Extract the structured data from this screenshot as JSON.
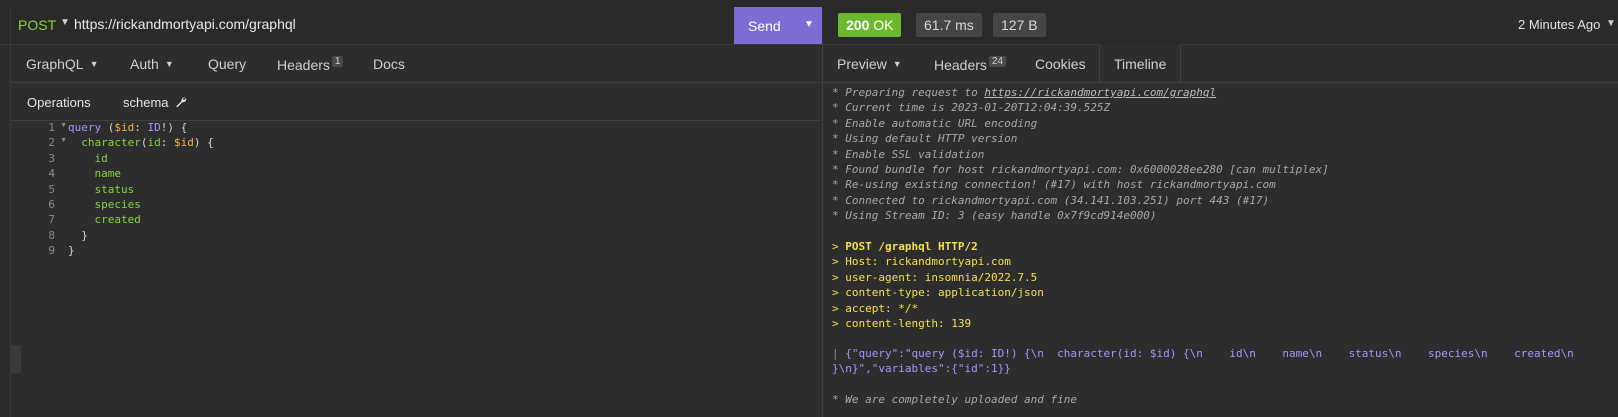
{
  "request": {
    "method": "POST",
    "url": "https://rickandmortyapi.com/graphql",
    "send_label": "Send"
  },
  "response": {
    "status_code": "200",
    "status_text": "OK",
    "time": "61.7 ms",
    "size": "127 B",
    "history_label": "2 Minutes Ago"
  },
  "left_tabs": [
    {
      "label": "GraphQL"
    },
    {
      "label": "Auth"
    },
    {
      "label": "Query"
    },
    {
      "label": "Headers",
      "count": "1"
    },
    {
      "label": "Docs"
    }
  ],
  "sub_tabs": {
    "operations": "Operations",
    "schema": "schema"
  },
  "editor": {
    "line_numbers": [
      "1",
      "2",
      "3",
      "4",
      "5",
      "6",
      "7",
      "8",
      "9"
    ],
    "fields": [
      "id",
      "name",
      "status",
      "species",
      "created"
    ]
  },
  "right_tabs": [
    {
      "label": "Preview"
    },
    {
      "label": "Headers",
      "count": "24"
    },
    {
      "label": "Cookies"
    },
    {
      "label": "Timeline"
    }
  ],
  "timeline": {
    "info": [
      "* Preparing request to ",
      "* Current time is 2023-01-20T12:04:39.525Z",
      "* Enable automatic URL encoding",
      "* Using default HTTP version",
      "* Enable SSL validation",
      "* Found bundle for host rickandmortyapi.com: 0x6000028ee280 [can multiplex]",
      "* Re-using existing connection! (#17) with host rickandmortyapi.com",
      "* Connected to rickandmortyapi.com (34.141.103.251) port 443 (#17)",
      "* Using Stream ID: 3 (easy handle 0x7f9cd914e000)"
    ],
    "info_link": "https://rickandmortyapi.com/graphql",
    "request_lines": [
      "POST /graphql HTTP/2",
      "Host: rickandmortyapi.com",
      "user-agent: insomnia/2022.7.5",
      "content-type: application/json",
      "accept: */*",
      "content-length: 139"
    ],
    "body_line_1": "{\"query\":\"query ($id: ID!) {\\n  character(id: $id) {\\n    id\\n    name\\n    status\\n    species\\n    created\\n",
    "body_line_2": "}\\n}\",\"variables\":{\"id\":1}}",
    "footer": "* We are completely uploaded and fine"
  },
  "colors": {
    "send": "#7e6bd3",
    "ok": "#6cb92f",
    "keyword": "#a993ff",
    "variable": "#f5b341",
    "field": "#84d243",
    "request_text": "#f4e04d"
  }
}
